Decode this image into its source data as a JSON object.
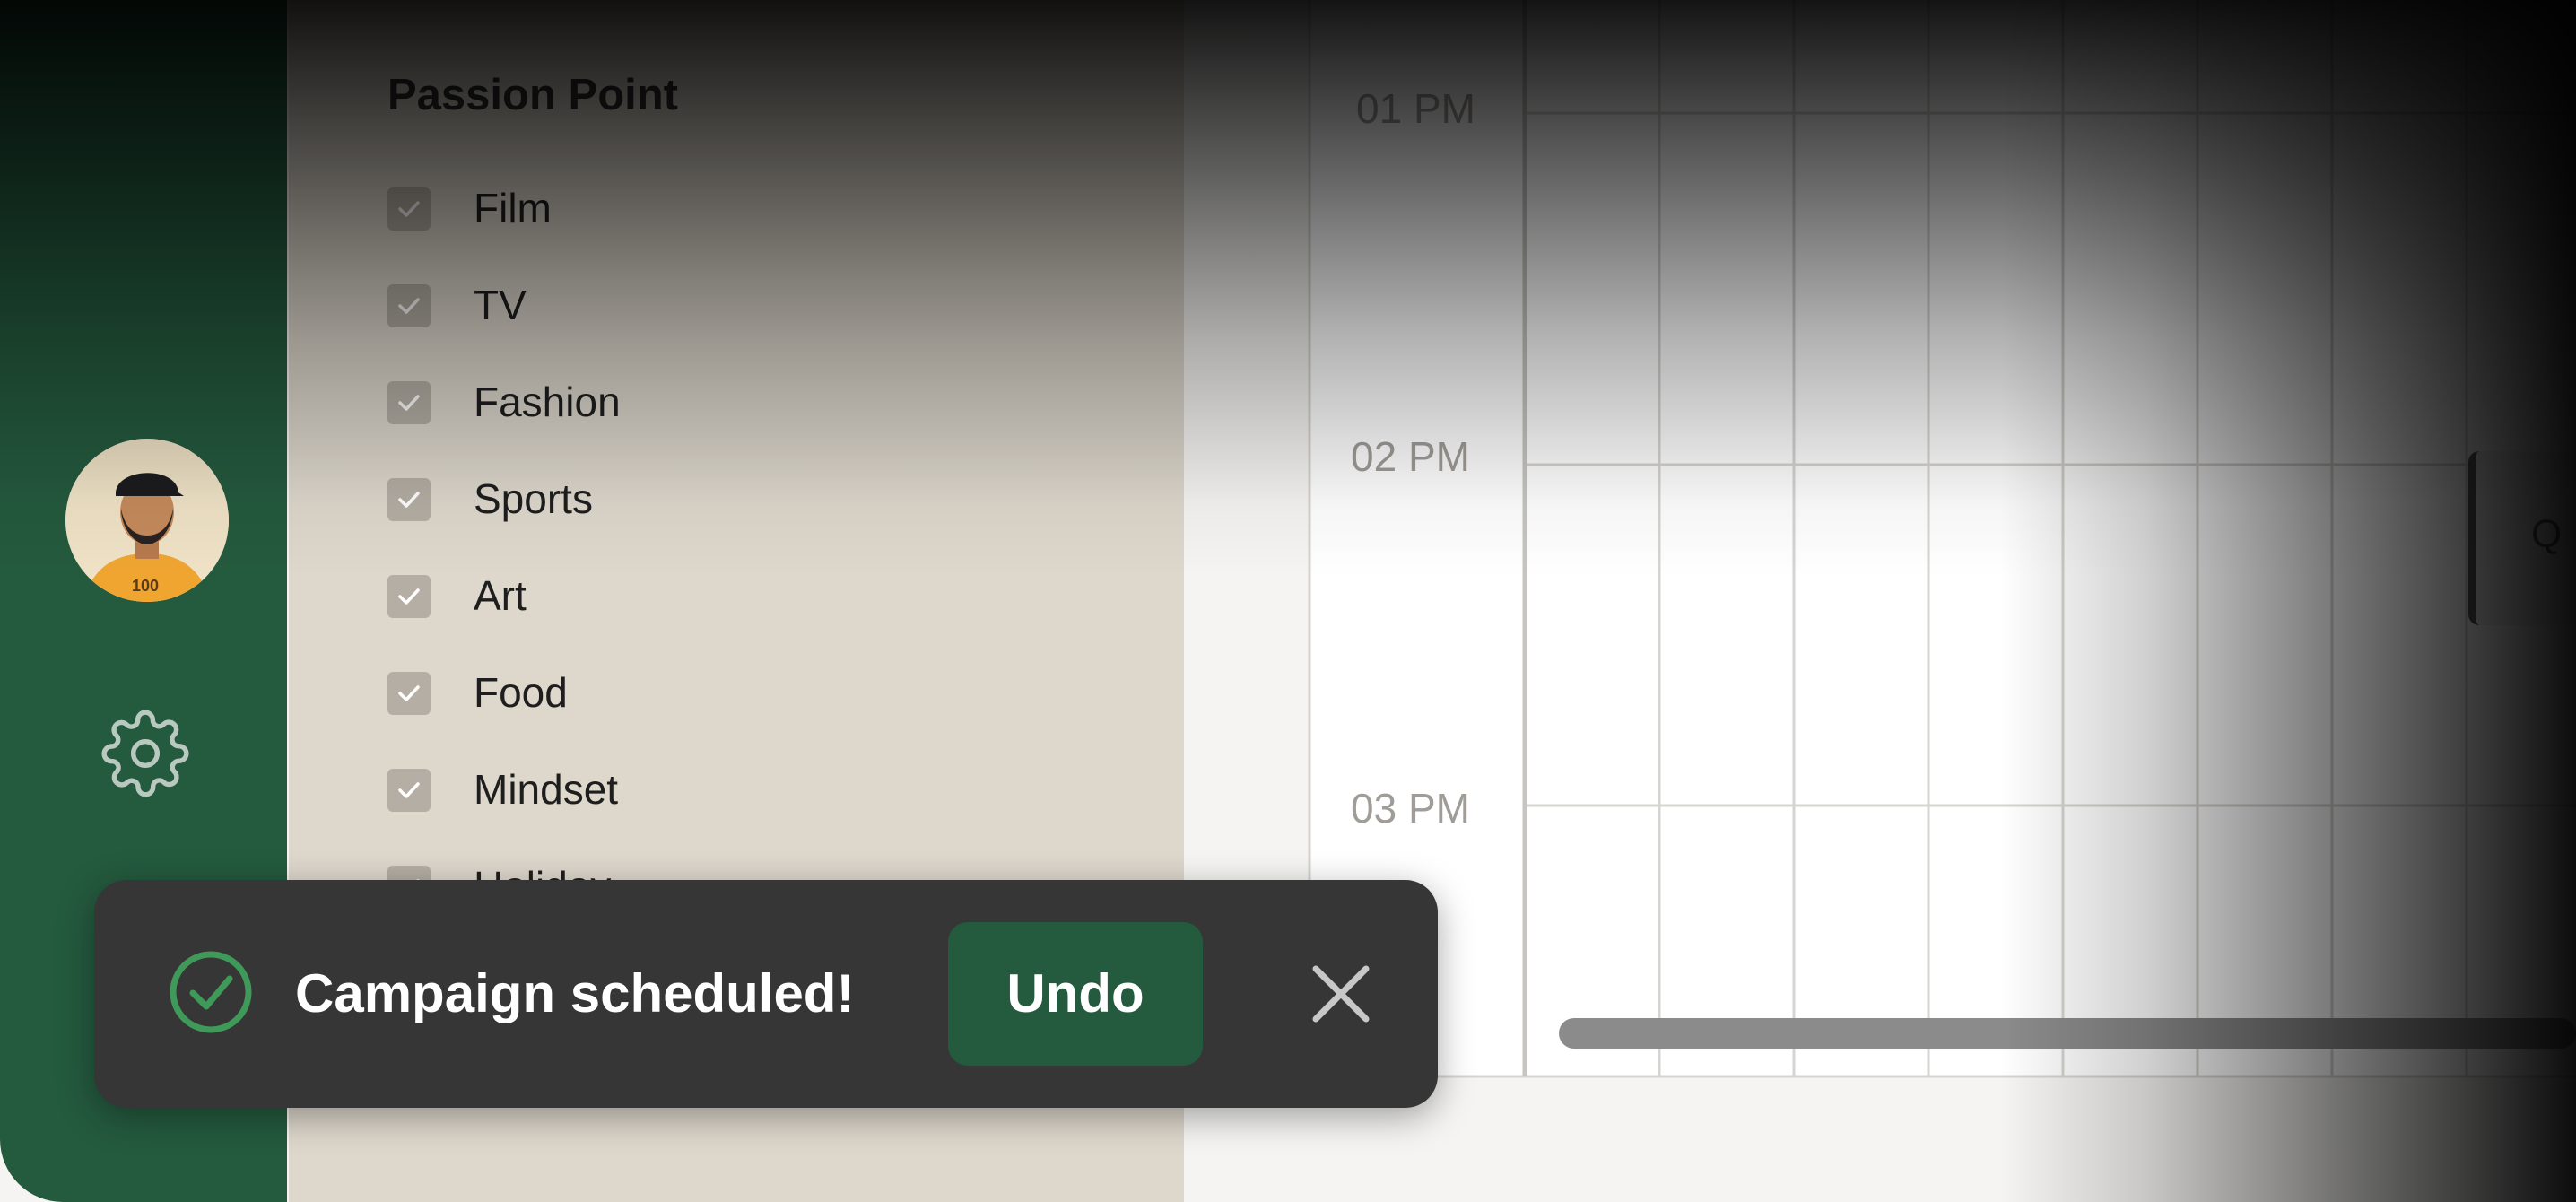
{
  "sidebar": {
    "avatar_alt": "user-avatar",
    "settings_icon": "gear-icon",
    "colors": {
      "background": "#245a3e"
    }
  },
  "filters": {
    "title": "Passion Point",
    "items": [
      {
        "label": "Film",
        "checked": true
      },
      {
        "label": "TV",
        "checked": true
      },
      {
        "label": "Fashion",
        "checked": true
      },
      {
        "label": "Sports",
        "checked": true
      },
      {
        "label": "Art",
        "checked": true
      },
      {
        "label": "Food",
        "checked": true
      },
      {
        "label": "Mindset",
        "checked": true
      },
      {
        "label": "Holiday",
        "checked": true
      }
    ]
  },
  "calendar": {
    "time_slots": [
      "01 PM",
      "02 PM",
      "03 PM"
    ],
    "event_preview_text": "Q"
  },
  "toast": {
    "message": "Campaign scheduled!",
    "undo_label": "Undo",
    "icon": "check-circle-icon",
    "close_icon": "close-icon",
    "colors": {
      "background": "#363636",
      "accent": "#3f9a5a",
      "button": "#245a3e"
    }
  }
}
